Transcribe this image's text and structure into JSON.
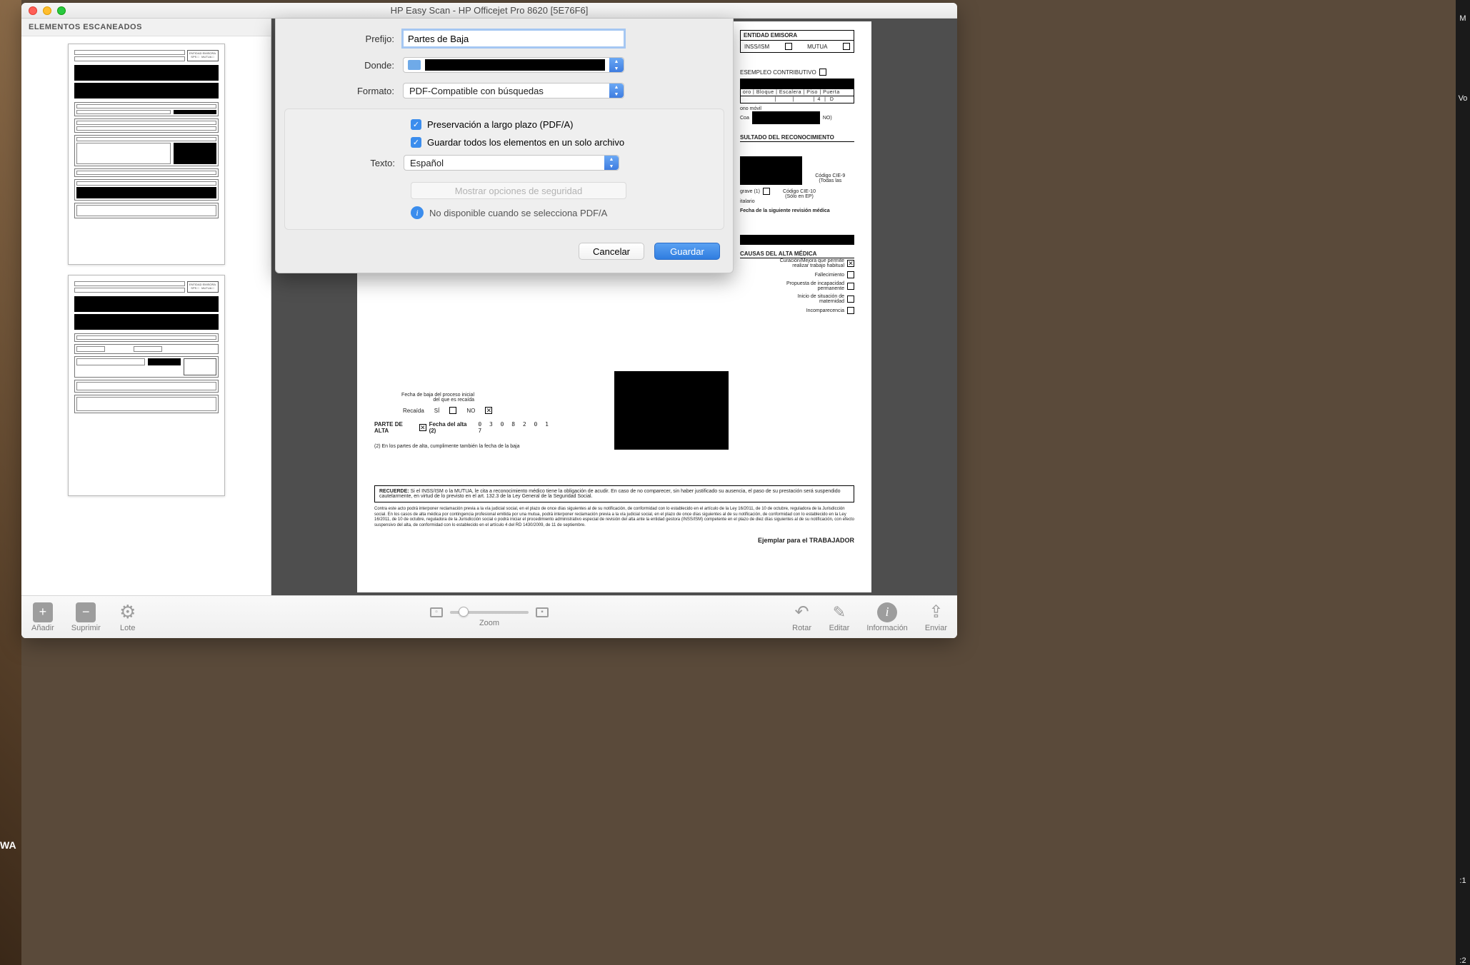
{
  "window": {
    "title": "HP Easy Scan - HP Officejet Pro 8620 [5E76F6]"
  },
  "sidebar": {
    "header": "ELEMENTOS ESCANEADOS"
  },
  "dialog": {
    "rows": {
      "prefix": {
        "label": "Prefijo:",
        "value": "Partes de Baja"
      },
      "where": {
        "label": "Donde:"
      },
      "format": {
        "label": "Formato:",
        "value": "PDF-Compatible con búsquedas"
      },
      "text": {
        "label": "Texto:",
        "value": "Español"
      }
    },
    "checks": {
      "pdfa": "Preservación a largo plazo (PDF/A)",
      "onefile": "Guardar todos los elementos en un solo archivo"
    },
    "security_btn": "Mostrar opciones de seguridad",
    "info": "No disponible cuando se selecciona PDF/A",
    "cancel": "Cancelar",
    "save": "Guardar"
  },
  "toolbar": {
    "add": "Añadir",
    "delete": "Suprimir",
    "batch": "Lote",
    "zoom": "Zoom",
    "rotate": "Rotar",
    "edit": "Editar",
    "info": "Información",
    "send": "Enviar"
  },
  "page": {
    "ent_head": "ENTIDAD EMISORA",
    "inss": "INSS/ISM",
    "mutua": "MUTUA",
    "desempleo": "ESEMPLEO CONTRIBUTIVO",
    "addr_cols": "oro | Bloque | Escalera | Piso | Puerta",
    "addr_vals": "          |            |              |  4   |   D",
    "movil": "ono móvil",
    "coa": "Coa",
    "no_suffix": "NO)",
    "recon": "SULTADO DEL RECONOCIMIENTO",
    "cie9": "Código CIE-9 (Todas las",
    "cie10": "Código CIE-10",
    "cie10b": "(Sólo en EP)",
    "grave": "grave (1)",
    "italario": "italario",
    "revision": "Fecha de la siguiente revisión  médica",
    "causas": "CAUSAS DEL ALTA MÉDICA",
    "c1a": "Curación/Mejora que permite",
    "c1b": "realizar trabajo habitual",
    "c2": "Fallecimiento",
    "c3a": "Propuesta de incapacidad",
    "c3b": "permanente",
    "c4a": "Inicio de situación de",
    "c4b": "maternidad",
    "c5": "Incomparecencia",
    "recaida": "Recaída",
    "si": "SÍ",
    "no": "NO",
    "fbaja1": "Fecha de baja del proceso inicial",
    "fbaja2": "del que es recaída",
    "palta": "PARTE DE ALTA",
    "falta": "Fecha del alta (2)",
    "falta_date": "0 3 0 8 2 0 1 7",
    "note2": "(2) En los partes de alta, cumplimente también la fecha de la baja",
    "rec_h": "RECUERDE:",
    "rec_t": "Si el INSS/ISM o la MUTUA, le cita a reconocimiento médico tiene la obligación de acudir. En caso de no comparecer, sin haber justificado su ausencia, el paso de su prestación será suspendido cautelarmente, en virtud de lo previsto en el art. 132.3 de la Ley General de la Seguridad Social.",
    "fine": "Contra este acto podrá interponer reclamación previa a la vía judicial social, en el plazo de once días siguientes al de su notificación, de conformidad con lo establecido en el artículo de la Ley 16/2011, de 10 de octubre, reguladora de la Jurisdicción social.\nEn los casos de alta médica por contingencia profesional emitida por una mutua, podrá interponer reclamación previa a la vía judicial social, en el plazo de once días siguientes al de su notificación, de conformidad con lo establecido en la Ley 16/2011, de 10 de octubre, reguladora de la Jurisdicción social o podrá iniciar el procedimiento administrativo especial de revisión del alta ante la entidad gestora (INSS/ISM) competente en el plazo de diez días siguientes al de su notificación, con efecto suspensivo del alta, de conformidad con lo establecido en el artículo 4 del RD 1430/2009, de 11 de septiembre.",
    "ejemplar": "Ejemplar para el TRABAJADOR"
  },
  "edge": {
    "wa": "WA",
    "m": "M",
    "vo": "Vo",
    "t1": ":1",
    "t2": ":2"
  }
}
